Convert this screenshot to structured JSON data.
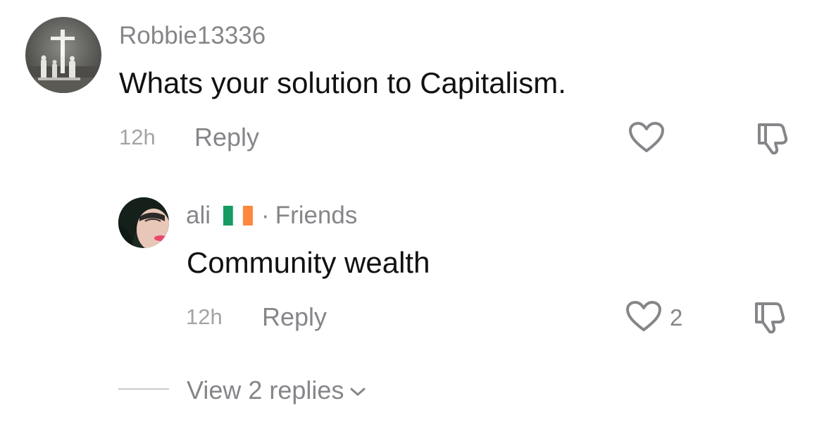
{
  "comment": {
    "username": "Robbie13336",
    "text": "Whats your solution to Capitalism.",
    "time": "12h",
    "reply_label": "Reply",
    "avatar_icon": "crucifixion-statue-avatar",
    "heart_icon": "heart-outline-icon",
    "dislike_icon": "thumbs-down-icon"
  },
  "reply": {
    "username": "ali",
    "flag_icon": "ireland-flag",
    "separator": "·",
    "relation": "Friends",
    "text": "Community wealth",
    "time": "12h",
    "reply_label": "Reply",
    "like_count": "2",
    "avatar_icon": "user-face-avatar",
    "heart_icon": "heart-outline-icon",
    "dislike_icon": "thumbs-down-icon"
  },
  "view_replies": {
    "label": "View 2 replies",
    "icon": "chevron-down-icon"
  },
  "colors": {
    "primary_text": "#111111",
    "secondary_text": "#86868a",
    "time_text": "#a3a3a8",
    "flag_green": "#169b62",
    "flag_white": "#ffffff",
    "flag_orange": "#ff883e"
  }
}
